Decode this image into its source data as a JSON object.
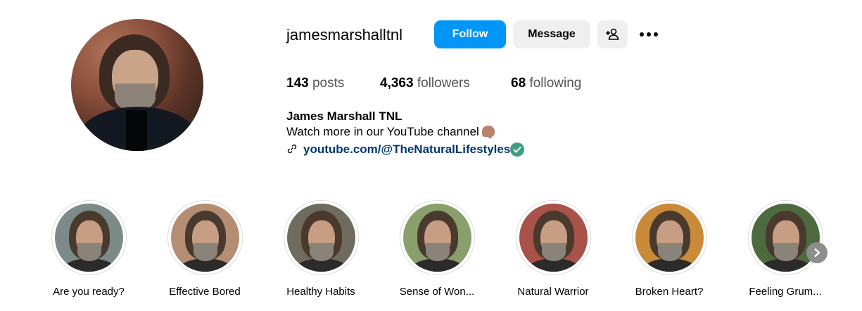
{
  "profile": {
    "username": "jamesmarshalltnl",
    "follow_label": "Follow",
    "message_label": "Message",
    "add_user_icon": "add-user-icon",
    "more_icon": "more-horizontal-icon",
    "accent_color": "#0095f6",
    "link_color": "#00376b",
    "verified_color": "#3d9e80"
  },
  "stats": [
    {
      "value": "143",
      "label": "posts"
    },
    {
      "value": "4,363",
      "label": "followers"
    },
    {
      "value": "68",
      "label": "following"
    }
  ],
  "bio": {
    "full_name": "James Marshall TNL",
    "text": "Watch more in our YouTube channel",
    "emoji_icon": "pointing-down-hand-icon",
    "link_icon": "link-chain-icon",
    "link": "youtube.com/@TheNaturalLifestyles",
    "verified_icon": "verified-check-icon"
  },
  "highlights": [
    {
      "label": "Are you ready?",
      "bg": "#7c8b8a"
    },
    {
      "label": "Effective Bored",
      "bg": "#b58d73"
    },
    {
      "label": "Healthy Habits",
      "bg": "#6f6b5e"
    },
    {
      "label": "Sense of Won...",
      "bg": "#8aa06c"
    },
    {
      "label": "Natural Warrior",
      "bg": "#a8524a"
    },
    {
      "label": "Broken Heart?",
      "bg": "#c98a3a"
    },
    {
      "label": "Feeling Grum...",
      "bg": "#4e6b3f"
    }
  ],
  "next_icon": "chevron-right-icon"
}
